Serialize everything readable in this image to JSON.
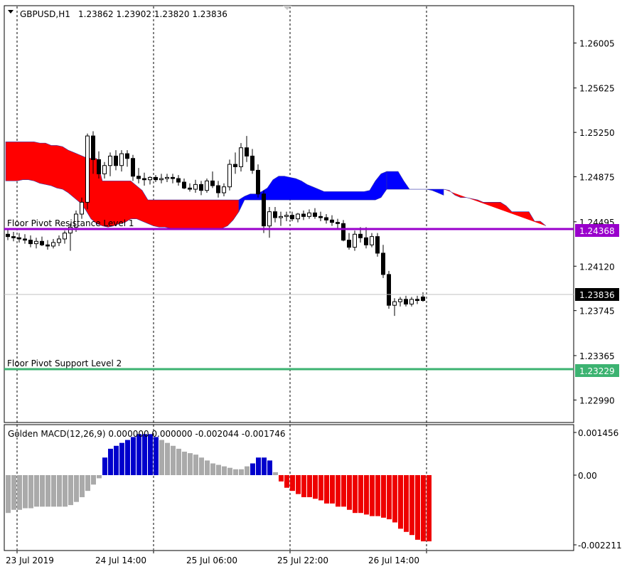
{
  "window": {
    "symbol_title": "GBPUSD,H1",
    "ohlc": "1.23862 1.23902 1.23820 1.23836"
  },
  "main_pane": {
    "price_ticks": [
      "1.26005",
      "1.25625",
      "1.25250",
      "1.24875",
      "1.24495",
      "1.24120",
      "1.23745",
      "1.23365",
      "1.22990"
    ],
    "resistance_line": {
      "label": "Floor Pivot Resistance Level 1",
      "price": "1.24368",
      "color": "#9900cc"
    },
    "support_line": {
      "label": "Floor Pivot Support Level 2",
      "price": "1.23229",
      "color": "#3cb371"
    },
    "current_price": "1.23836"
  },
  "macd_pane": {
    "title": "Golden MACD(12,26,9) 0.000000 0.000000 -0.002044 -0.001746",
    "ticks": [
      "0.001456",
      "0.00",
      "-0.002211"
    ]
  },
  "time_axis": {
    "labels": [
      "23 Jul 2019",
      "24 Jul 14:00",
      "25 Jul 06:00",
      "25 Jul 22:00",
      "26 Jul 14:00"
    ]
  },
  "colors": {
    "cloud_bearish": "#ff0000",
    "cloud_bullish": "#0000ff",
    "hist_grey": "#aaaaaa",
    "hist_blue": "#0000cc",
    "hist_red": "#ee0000"
  },
  "chart_data": [
    {
      "type": "candlestick",
      "symbol": "GBPUSD",
      "timeframe": "H1",
      "ylim": [
        1.228,
        1.2632
      ],
      "bars_per_gridline": 16,
      "candles": [
        [
          1.2439,
          1.2444,
          1.2434,
          1.2437
        ],
        [
          1.2437,
          1.2441,
          1.2433,
          1.2436
        ],
        [
          1.2436,
          1.244,
          1.2432,
          1.2435
        ],
        [
          1.2435,
          1.2439,
          1.2431,
          1.2434
        ],
        [
          1.2434,
          1.2438,
          1.2428,
          1.2431
        ],
        [
          1.2431,
          1.2436,
          1.2427,
          1.2433
        ],
        [
          1.2433,
          1.2437,
          1.2429,
          1.243
        ],
        [
          1.243,
          1.2434,
          1.2426,
          1.2429
        ],
        [
          1.2429,
          1.2435,
          1.2427,
          1.2432
        ],
        [
          1.2432,
          1.2438,
          1.2429,
          1.2435
        ],
        [
          1.2435,
          1.2442,
          1.2431,
          1.244
        ],
        [
          1.244,
          1.2448,
          1.2425,
          1.2445
        ],
        [
          1.2445,
          1.2459,
          1.2441,
          1.2456
        ],
        [
          1.2456,
          1.247,
          1.2452,
          1.2466
        ],
        [
          1.2466,
          1.2524,
          1.246,
          1.2522
        ],
        [
          1.2522,
          1.2526,
          1.249,
          1.2502
        ],
        [
          1.2502,
          1.2509,
          1.2486,
          1.249
        ],
        [
          1.249,
          1.25,
          1.2486,
          1.2497
        ],
        [
          1.2497,
          1.2508,
          1.2488,
          1.2505
        ],
        [
          1.2505,
          1.251,
          1.2493,
          1.2497
        ],
        [
          1.2497,
          1.251,
          1.2492,
          1.2507
        ],
        [
          1.2507,
          1.251,
          1.2496,
          1.2503
        ],
        [
          1.2503,
          1.2506,
          1.2484,
          1.2488
        ],
        [
          1.2488,
          1.2495,
          1.2482,
          1.2486
        ],
        [
          1.2486,
          1.2491,
          1.248,
          1.2485
        ],
        [
          1.2485,
          1.2488,
          1.2481,
          1.2487
        ],
        [
          1.2487,
          1.2489,
          1.2483,
          1.2485
        ],
        [
          1.2485,
          1.249,
          1.2482,
          1.2486
        ],
        [
          1.2486,
          1.249,
          1.2483,
          1.2487
        ],
        [
          1.2487,
          1.249,
          1.2482,
          1.2486
        ],
        [
          1.2486,
          1.2489,
          1.248,
          1.2483
        ],
        [
          1.2483,
          1.2486,
          1.2477,
          1.2478
        ],
        [
          1.2478,
          1.2482,
          1.2475,
          1.2477
        ],
        [
          1.2477,
          1.2485,
          1.2474,
          1.2481
        ],
        [
          1.2481,
          1.2484,
          1.2472,
          1.2476
        ],
        [
          1.2476,
          1.2486,
          1.2474,
          1.2484
        ],
        [
          1.2484,
          1.2492,
          1.2478,
          1.248
        ],
        [
          1.248,
          1.2484,
          1.247,
          1.2474
        ],
        [
          1.2474,
          1.2482,
          1.2471,
          1.2479
        ],
        [
          1.2479,
          1.2502,
          1.2476,
          1.2498
        ],
        [
          1.2498,
          1.2508,
          1.249,
          1.2496
        ],
        [
          1.2496,
          1.2516,
          1.2492,
          1.2512
        ],
        [
          1.2512,
          1.2522,
          1.25,
          1.2505
        ],
        [
          1.2505,
          1.2511,
          1.249,
          1.2493
        ],
        [
          1.2493,
          1.2498,
          1.247,
          1.2473
        ],
        [
          1.2473,
          1.2476,
          1.244,
          1.2446
        ],
        [
          1.2446,
          1.2462,
          1.2436,
          1.2458
        ],
        [
          1.2458,
          1.2462,
          1.2449,
          1.2453
        ],
        [
          1.2453,
          1.2458,
          1.2446,
          1.2454
        ],
        [
          1.2454,
          1.2458,
          1.245,
          1.2455
        ],
        [
          1.2455,
          1.2458,
          1.245,
          1.2452
        ],
        [
          1.2452,
          1.2457,
          1.2449,
          1.2456
        ],
        [
          1.2456,
          1.2459,
          1.2451,
          1.2454
        ],
        [
          1.2454,
          1.246,
          1.2452,
          1.2457
        ],
        [
          1.2457,
          1.2461,
          1.2452,
          1.2454
        ],
        [
          1.2454,
          1.2458,
          1.245,
          1.2453
        ],
        [
          1.2453,
          1.2456,
          1.2448,
          1.2451
        ],
        [
          1.2451,
          1.2455,
          1.2446,
          1.2449
        ],
        [
          1.2449,
          1.2452,
          1.2444,
          1.2448
        ],
        [
          1.2448,
          1.2451,
          1.2433,
          1.2434
        ],
        [
          1.2434,
          1.244,
          1.2426,
          1.2428
        ],
        [
          1.2428,
          1.2442,
          1.2425,
          1.2439
        ],
        [
          1.2439,
          1.2445,
          1.2432,
          1.2436
        ],
        [
          1.2436,
          1.2445,
          1.2427,
          1.243
        ],
        [
          1.243,
          1.244,
          1.2428,
          1.2437
        ],
        [
          1.2437,
          1.244,
          1.242,
          1.2423
        ],
        [
          1.2423,
          1.243,
          1.2402,
          1.2405
        ],
        [
          1.2405,
          1.2408,
          1.2376,
          1.2379
        ],
        [
          1.2379,
          1.2385,
          1.237,
          1.2382
        ],
        [
          1.2382,
          1.2386,
          1.2378,
          1.2384
        ],
        [
          1.2384,
          1.2387,
          1.2378,
          1.238
        ],
        [
          1.238,
          1.2386,
          1.2378,
          1.2384
        ],
        [
          1.2384,
          1.2387,
          1.238,
          1.2383
        ],
        [
          1.2386,
          1.239,
          1.2382,
          1.2383
        ]
      ]
    },
    {
      "type": "bar",
      "name": "Golden MACD(12,26,9)",
      "ylim": [
        -0.002211,
        0.001456
      ],
      "values": [
        -0.0012,
        -0.0011,
        -0.0011,
        -0.00105,
        -0.00105,
        -0.001,
        -0.001,
        -0.001,
        -0.001,
        -0.001,
        -0.001,
        -0.00095,
        -0.00085,
        -0.0007,
        -0.0005,
        -0.0003,
        -0.0001,
        0.0006,
        0.0009,
        0.001,
        0.0011,
        0.0012,
        0.0013,
        0.0014,
        0.0014,
        0.0014,
        0.0013,
        0.0012,
        0.0011,
        0.001,
        0.0009,
        0.0008,
        0.00075,
        0.0007,
        0.0006,
        0.0005,
        0.0004,
        0.00035,
        0.0003,
        0.00025,
        0.0002,
        0.0002,
        0.0003,
        0.0004,
        0.0006,
        0.0006,
        0.0005,
        0.0001,
        -0.0002,
        -0.0004,
        -0.0005,
        -0.0006,
        -0.0007,
        -0.0007,
        -0.00075,
        -0.0008,
        -0.0009,
        -0.0009,
        -0.001,
        -0.001,
        -0.0011,
        -0.0012,
        -0.0012,
        -0.00125,
        -0.0013,
        -0.0013,
        -0.00135,
        -0.0014,
        -0.0015,
        -0.0017,
        -0.0018,
        -0.0019,
        -0.00205,
        -0.0021,
        -0.0021
      ],
      "signal_cross_color_index": {
        "grey": [
          0,
          16,
          27,
          41,
          47
        ],
        "blue": [
          17,
          26,
          43,
          46
        ],
        "red": [
          48,
          74
        ]
      }
    }
  ]
}
